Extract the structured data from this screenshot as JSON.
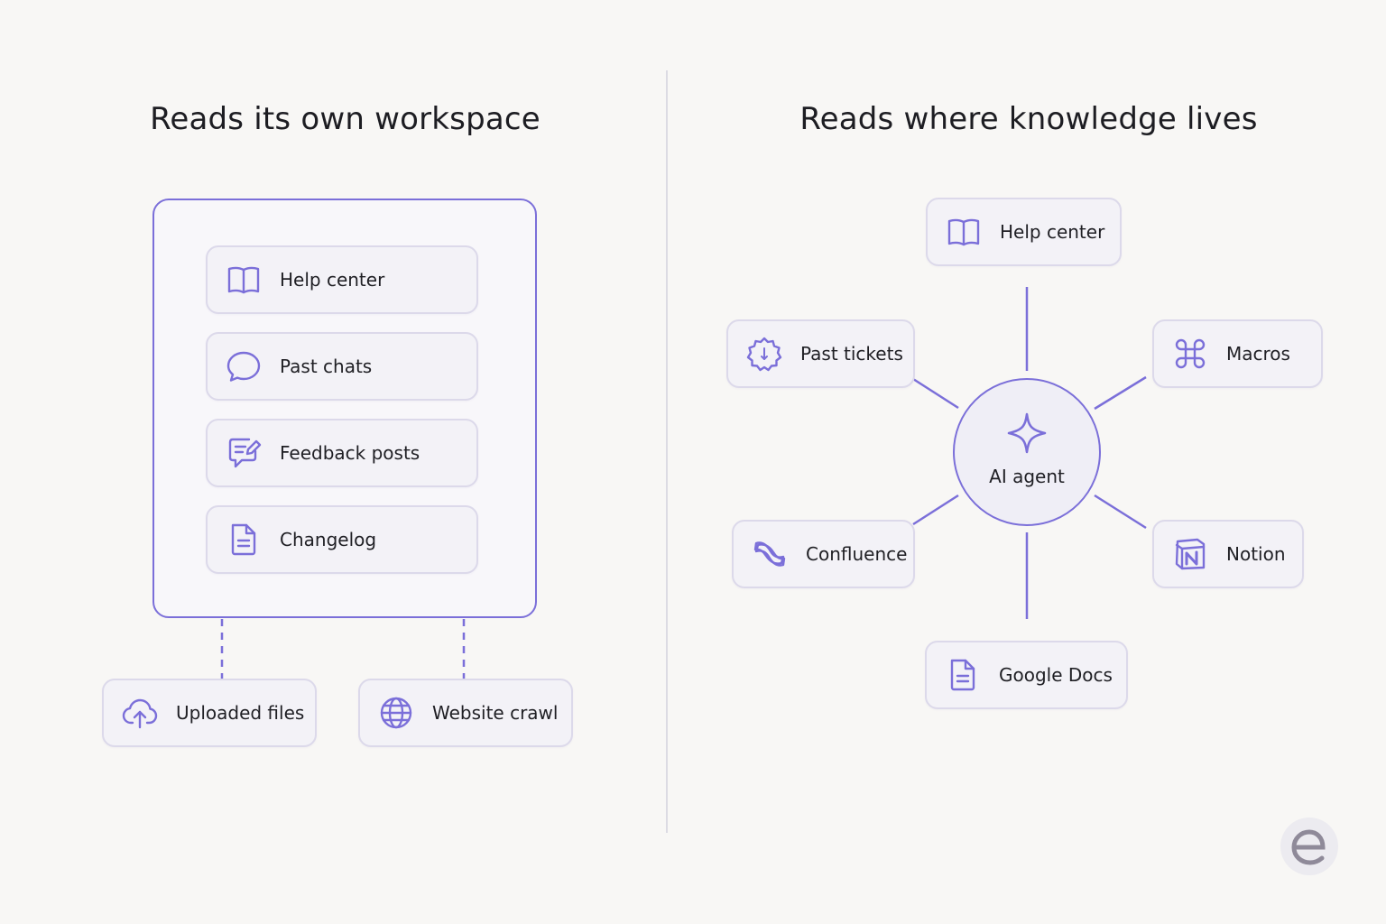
{
  "left_panel": {
    "title": "Reads its own workspace",
    "workspace_items": [
      {
        "label": "Help center",
        "icon": "book-icon"
      },
      {
        "label": "Past chats",
        "icon": "chat-bubble-icon"
      },
      {
        "label": "Feedback posts",
        "icon": "feedback-icon"
      },
      {
        "label": "Changelog",
        "icon": "document-icon"
      }
    ],
    "external_items": [
      {
        "label": "Uploaded files",
        "icon": "cloud-upload-icon"
      },
      {
        "label": "Website crawl",
        "icon": "globe-icon"
      }
    ]
  },
  "right_panel": {
    "title": "Reads where knowledge lives",
    "hub": {
      "label": "AI agent",
      "icon": "sparkle-icon"
    },
    "sources": {
      "help_center": {
        "label": "Help center",
        "icon": "book-icon"
      },
      "past_tickets": {
        "label": "Past tickets",
        "icon": "ticket-badge-icon"
      },
      "macros": {
        "label": "Macros",
        "icon": "command-icon"
      },
      "confluence": {
        "label": "Confluence",
        "icon": "confluence-icon"
      },
      "notion": {
        "label": "Notion",
        "icon": "notion-icon"
      },
      "google_docs": {
        "label": "Google Docs",
        "icon": "document-icon"
      }
    }
  },
  "colors": {
    "accent": "#7b6fd9",
    "card_background": "#f3f2f7",
    "card_border": "#dcd9ea",
    "page_background": "#f8f7f5"
  },
  "logo": {
    "icon": "e-logo-icon"
  }
}
